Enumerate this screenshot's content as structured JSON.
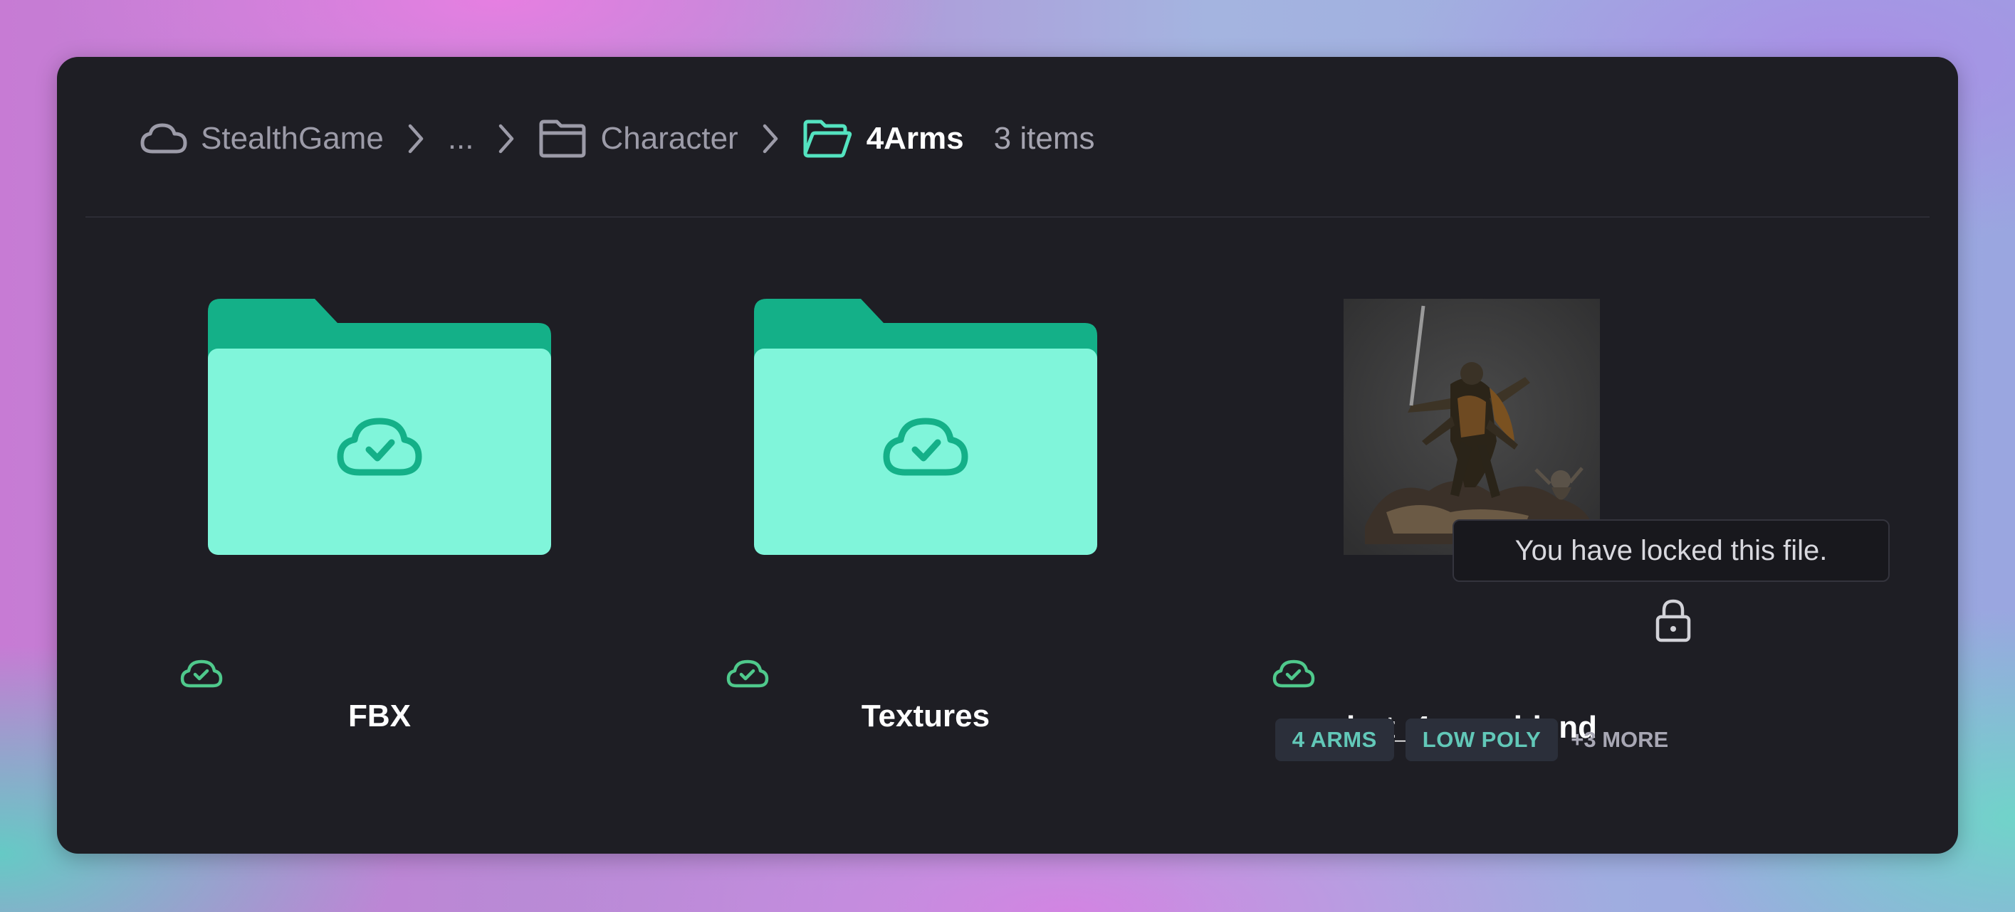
{
  "breadcrumb": {
    "root": {
      "label": "StealthGame",
      "icon": "cloud-icon"
    },
    "ellipsis": "...",
    "parent": {
      "label": "Character",
      "icon": "folder-icon"
    },
    "current": {
      "label": "4Arms",
      "icon": "folder-open-icon"
    },
    "count": "3 items",
    "separator_icon": "chevron-right-icon"
  },
  "items": [
    {
      "name": "FBX",
      "type": "folder",
      "thumb_icon": "cloud-check-icon",
      "sync_icon": "cloud-check-icon"
    },
    {
      "name": "Textures",
      "type": "folder",
      "thumb_icon": "cloud-check-icon",
      "sync_icon": "cloud-check-icon"
    },
    {
      "name": "bot_4arms.blend",
      "type": "file",
      "thumb": "3d-character-thumbnail",
      "sync_icon": "cloud-check-icon",
      "lock_icon": "lock-icon",
      "tags": [
        "4 ARMS",
        "LOW POLY"
      ],
      "more": "+3 MORE"
    }
  ],
  "tooltip": "You have locked this file.",
  "colors": {
    "panel": "#1e1e24",
    "folder_front": "#80f5da",
    "folder_back": "#14b088",
    "sync_green": "#4fc98c",
    "tag_bg": "#2b2f3a",
    "tag_text": "#62c8b8",
    "current_folder_icon": "#54e3c0"
  }
}
